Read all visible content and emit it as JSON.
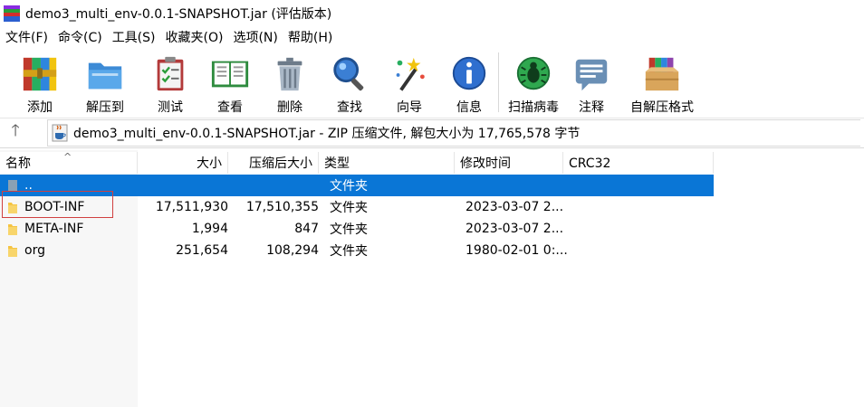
{
  "window": {
    "title": "demo3_multi_env-0.0.1-SNAPSHOT.jar (评估版本)"
  },
  "menu": [
    {
      "label": "文件(F)"
    },
    {
      "label": "命令(C)"
    },
    {
      "label": "工具(S)"
    },
    {
      "label": "收藏夹(O)"
    },
    {
      "label": "选项(N)"
    },
    {
      "label": "帮助(H)"
    }
  ],
  "toolbar": {
    "buttons": [
      {
        "label": "添加",
        "icon": "books-add-icon"
      },
      {
        "label": "解压到",
        "icon": "folder-extract-icon"
      },
      {
        "label": "测试",
        "icon": "clipboard-test-icon"
      },
      {
        "label": "查看",
        "icon": "book-view-icon"
      },
      {
        "label": "删除",
        "icon": "trash-icon"
      },
      {
        "label": "查找",
        "icon": "magnifier-icon"
      },
      {
        "label": "向导",
        "icon": "wizard-wand-icon"
      },
      {
        "label": "信息",
        "icon": "info-icon"
      },
      {
        "label": "扫描病毒",
        "icon": "virus-scan-icon"
      },
      {
        "label": "注释",
        "icon": "comment-icon"
      },
      {
        "label": "自解压格式",
        "icon": "sfx-box-icon"
      }
    ]
  },
  "address": {
    "up_glyph": "🡑",
    "path": "demo3_multi_env-0.0.1-SNAPSHOT.jar - ZIP 压缩文件, 解包大小为 17,765,578 字节"
  },
  "columns": {
    "name": "名称",
    "size": "大小",
    "packed": "压缩后大小",
    "type": "类型",
    "modified": "修改时间",
    "crc": "CRC32",
    "sort_glyph": "^"
  },
  "rows": [
    {
      "name": "..",
      "size": "",
      "packed": "",
      "type": "文件夹",
      "modified": "",
      "selected": true
    },
    {
      "name": "BOOT-INF",
      "size": "17,511,930",
      "packed": "17,510,355",
      "type": "文件夹",
      "modified": "2023-03-07 2..."
    },
    {
      "name": "META-INF",
      "size": "1,994",
      "packed": "847",
      "type": "文件夹",
      "modified": "2023-03-07 2..."
    },
    {
      "name": "org",
      "size": "251,654",
      "packed": "108,294",
      "type": "文件夹",
      "modified": "1980-02-01 0:..."
    }
  ],
  "colors": {
    "selection": "#0a76d6",
    "highlight_box": "#d04040",
    "folder": "#f5c442"
  }
}
